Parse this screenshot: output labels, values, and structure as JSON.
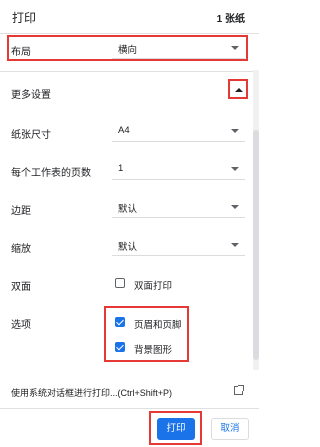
{
  "header": {
    "title": "打印",
    "sheet_count": "1 张纸"
  },
  "layout": {
    "label": "布局",
    "value": "横向"
  },
  "more_settings": {
    "label": "更多设置"
  },
  "paper_size": {
    "label": "纸张尺寸",
    "value": "A4"
  },
  "pages_per_sheet": {
    "label": "每个工作表的页数",
    "value": "1"
  },
  "margins": {
    "label": "边距",
    "value": "默认"
  },
  "scale": {
    "label": "缩放",
    "value": "默认"
  },
  "duplex": {
    "label": "双面",
    "checkbox_label": "双面打印",
    "checked": false
  },
  "options": {
    "label": "选项",
    "headers_footers": {
      "label": "页眉和页脚",
      "checked": true
    },
    "background_graphics": {
      "label": "背景图形",
      "checked": true
    }
  },
  "system_dialog": {
    "label": "使用系统对话框进行打印...(Ctrl+Shift+P)"
  },
  "buttons": {
    "print": "打印",
    "cancel": "取消"
  },
  "colors": {
    "accent": "#1a73e8",
    "highlight": "#e53935"
  }
}
